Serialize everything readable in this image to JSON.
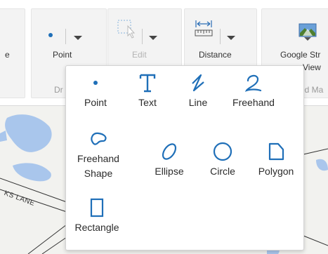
{
  "ribbon": {
    "point_label": "Point",
    "edit_label": "Edit",
    "distance_label": "Distance",
    "streetview_label_1": "Google Str",
    "streetview_label_2": "View",
    "left_group_label": "Dr",
    "right_group_label": "ed Ma",
    "left_edge_label": "e",
    "point_icon": "dot-icon",
    "edit_icon": "select-edit-icon",
    "distance_icon": "ruler-icon",
    "streetview_icon": "street-view-icon"
  },
  "map": {
    "road_label": "KS LANE"
  },
  "draw_menu": {
    "tools": [
      {
        "label": "Point",
        "icon": "point-icon"
      },
      {
        "label": "Text",
        "icon": "text-icon"
      },
      {
        "label": "Line",
        "icon": "line-icon"
      },
      {
        "label": "Freehand",
        "icon": "freehand-icon"
      },
      {
        "label": "Freehand Shape",
        "icon": "freehand-shape-icon"
      },
      {
        "label": "Ellipse",
        "icon": "ellipse-icon"
      },
      {
        "label": "Circle",
        "icon": "circle-icon"
      },
      {
        "label": "Polygon",
        "icon": "polygon-icon"
      },
      {
        "label": "Rectangle",
        "icon": "rectangle-icon"
      }
    ],
    "accent_color": "#1f6fb8"
  }
}
